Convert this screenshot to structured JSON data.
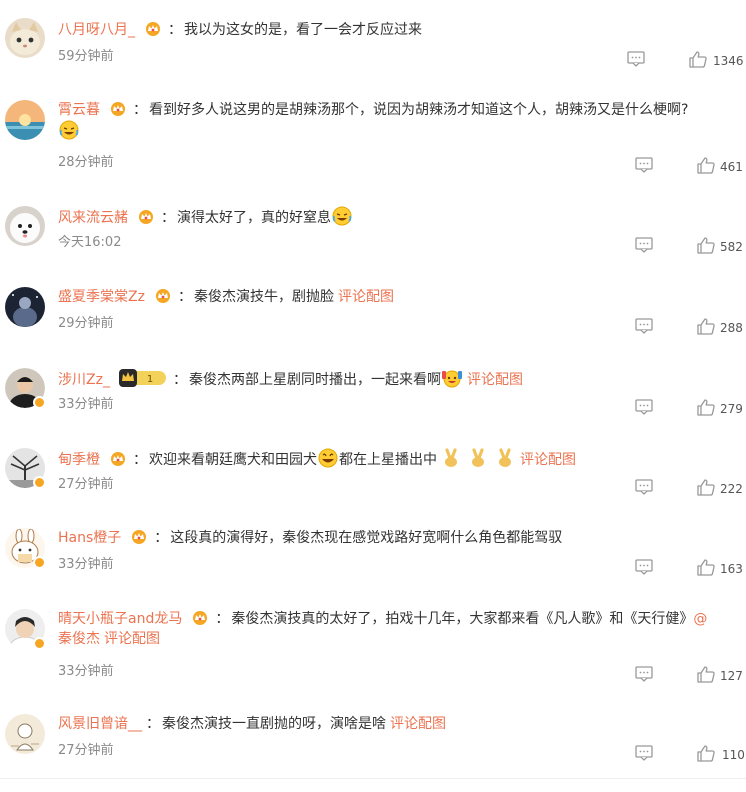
{
  "comments": [
    {
      "name": "八月呀八月_",
      "text": "我以为这女的是，看了一会才反应过来",
      "time": "59分钟前",
      "likes": "1346",
      "avatar": "cat",
      "badge": "crown"
    },
    {
      "name": "霄云暮",
      "text": "看到好多人说这男的是胡辣汤那个，说因为胡辣汤才知道这个人，胡辣汤又是什么梗啊?",
      "time": "28分钟前",
      "likes": "461",
      "avatar": "sunset",
      "badge": "crown"
    },
    {
      "name": "风来流云赭",
      "text": "演得太好了，真的好窒息",
      "time": "今天16:02",
      "likes": "582",
      "avatar": "dog",
      "badge": "crown"
    },
    {
      "name": "盛夏季棠棠Zz",
      "text": "秦俊杰演技牛，剧抛脸",
      "pic": "评论配图",
      "time": "29分钟前",
      "likes": "288",
      "avatar": "night",
      "badge": "crown"
    },
    {
      "name": "涉川Zz_",
      "text": "秦俊杰两部上星剧同时播出，一起来看啊",
      "pic": "评论配图",
      "time": "33分钟前",
      "likes": "279",
      "avatar": "man",
      "badge": "level",
      "level": "1",
      "verified": true
    },
    {
      "name": "甸季橙",
      "text": "欢迎来看朝廷鹰犬和田园犬",
      "text2": "都在上星播出中",
      "pic": "评论配图",
      "time": "27分钟前",
      "likes": "222",
      "avatar": "tree",
      "badge": "crown",
      "verified": true
    },
    {
      "name": "Hans橙子",
      "text": "这段真的演得好，秦俊杰现在感觉戏路好宽啊什么角色都能驾驭",
      "time": "33分钟前",
      "likes": "163",
      "avatar": "bunny",
      "badge": "crown",
      "verified": true
    },
    {
      "name": "晴天小瓶子and龙马",
      "text": "秦俊杰演技真的太好了，拍戏十几年，大家都来看《凡人歌》和《天行健》",
      "at": "@",
      "text2": "秦俊杰",
      "pic": "评论配图",
      "time": "33分钟前",
      "likes": "127",
      "avatar": "boy",
      "badge": "crown",
      "verified": true
    },
    {
      "name": "风景旧曾谙__",
      "text": "秦俊杰演技一直剧抛的呀，演啥是啥",
      "pic": "评论配图",
      "time": "27分钟前",
      "likes": "110",
      "avatar": "sketch",
      "badge": "none"
    }
  ],
  "colon": "：",
  "colors": {
    "name": "#eb7350",
    "time": "#8a8a8a",
    "text": "#333333",
    "icon": "#999999"
  },
  "icons": {
    "comment": "comment-icon",
    "like": "thumbs-up-icon",
    "crown": "crown-badge-icon",
    "verified": "verified-badge-icon"
  }
}
